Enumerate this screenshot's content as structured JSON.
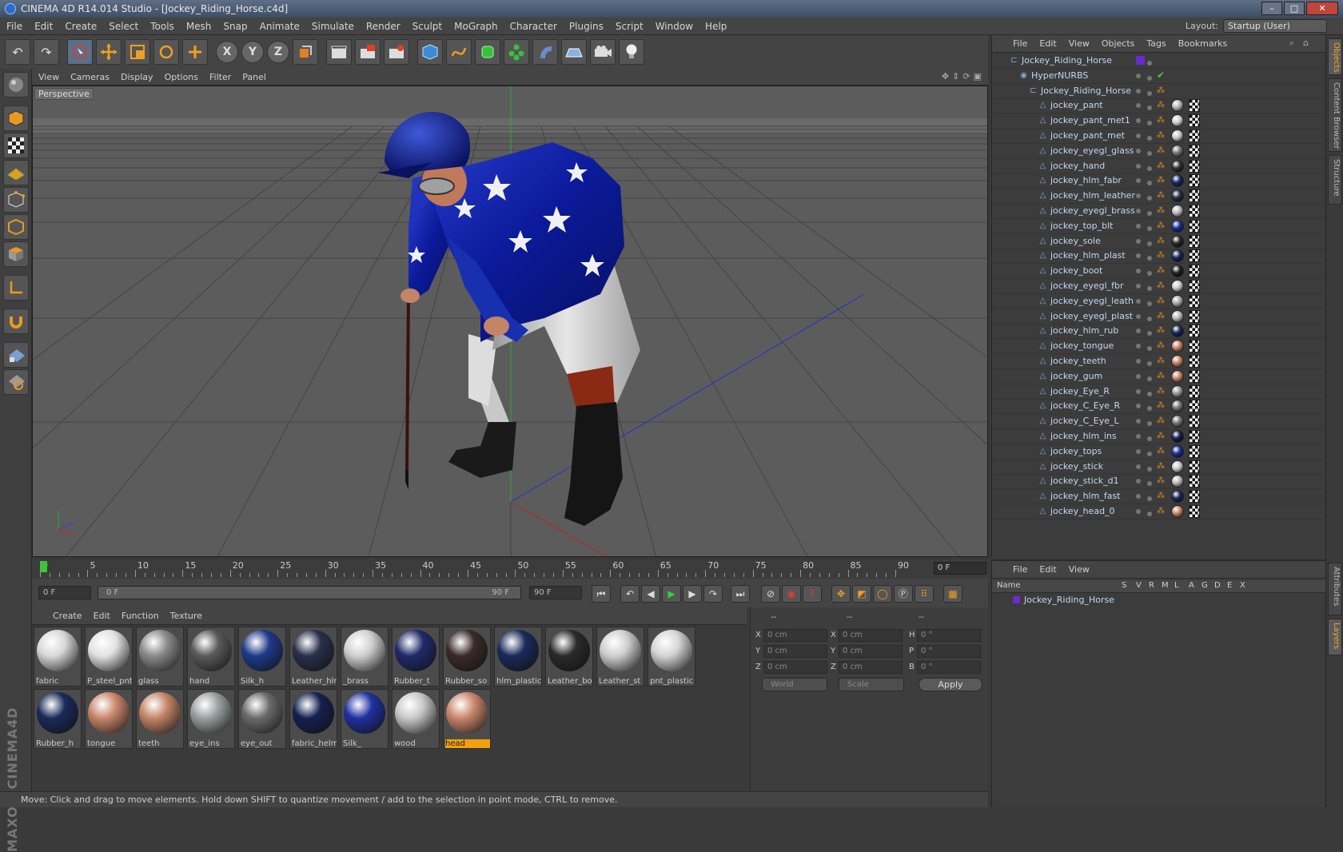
{
  "window": {
    "title": "CINEMA 4D R14.014 Studio - [Jockey_Riding_Horse.c4d]",
    "buttons": [
      "–",
      "□",
      "✕"
    ]
  },
  "menubar": {
    "items": [
      "File",
      "Edit",
      "Create",
      "Select",
      "Tools",
      "Mesh",
      "Snap",
      "Animate",
      "Simulate",
      "Render",
      "Sculpt",
      "MoGraph",
      "Character",
      "Plugins",
      "Script",
      "Window",
      "Help"
    ],
    "layout_label": "Layout:",
    "layout_value": "Startup (User)"
  },
  "toolbar": {
    "undo_icon": "↶",
    "redo_icon": "↷",
    "axis_x": "X",
    "axis_y": "Y",
    "axis_z": "Z"
  },
  "viewport": {
    "menu": [
      "View",
      "Cameras",
      "Display",
      "Options",
      "Filter",
      "Panel"
    ],
    "camera_label": "Perspective"
  },
  "timeline": {
    "ticks": [
      "0",
      "5",
      "10",
      "15",
      "20",
      "25",
      "30",
      "35",
      "40",
      "45",
      "50",
      "55",
      "60",
      "65",
      "70",
      "75",
      "80",
      "85",
      "90"
    ],
    "current_frame": "0 F"
  },
  "transport": {
    "start_field": "0 F",
    "range_start": "0 F",
    "range_end": "90 F",
    "end_field": "90 F"
  },
  "materials": {
    "menu": [
      "Create",
      "Edit",
      "Function",
      "Texture"
    ],
    "items": [
      {
        "name": "fabric",
        "color": "#d8d8d8"
      },
      {
        "name": "P_steel_pnt",
        "color": "#e2e2e2"
      },
      {
        "name": "glass",
        "color": "#8a8a8a"
      },
      {
        "name": "hand",
        "color": "#5a5a5a"
      },
      {
        "name": "Silk_h",
        "color": "#1e3a8a"
      },
      {
        "name": "Leather_hlm",
        "color": "#2a2f4a"
      },
      {
        "name": "_brass",
        "color": "#d0d0d0"
      },
      {
        "name": "Rubber_t",
        "color": "#202a6a"
      },
      {
        "name": "Rubber_so",
        "color": "#3a2a2a"
      },
      {
        "name": "hlm_plastic",
        "color": "#1a2a5a"
      },
      {
        "name": "Leather_bo",
        "color": "#2a2a2a"
      },
      {
        "name": "Leather_st",
        "color": "#cfcfcf"
      },
      {
        "name": "pnt_plastic",
        "color": "#d4d4d4"
      },
      {
        "name": "Rubber_h",
        "color": "#1a2a5a"
      },
      {
        "name": "tongue",
        "color": "#c9866a"
      },
      {
        "name": "teeth",
        "color": "#c48566"
      },
      {
        "name": "eye_ins",
        "color": "#9aa0a0"
      },
      {
        "name": "eye_out",
        "color": "#6a6a6a"
      },
      {
        "name": "fabric_helm",
        "color": "#152050"
      },
      {
        "name": "Silk_",
        "color": "#2030a0"
      },
      {
        "name": "wood",
        "color": "#c8c8c8"
      },
      {
        "name": "head",
        "color": "#c9866a",
        "selected": true
      }
    ]
  },
  "coordinates": {
    "headers": [
      "--",
      "--",
      "--"
    ],
    "rows": [
      {
        "a": "X",
        "av": "0 cm",
        "b": "X",
        "bv": "0 cm",
        "c": "H",
        "cv": "0 °"
      },
      {
        "a": "Y",
        "av": "0 cm",
        "b": "Y",
        "bv": "0 cm",
        "c": "P",
        "cv": "0 °"
      },
      {
        "a": "Z",
        "av": "0 cm",
        "b": "Z",
        "bv": "0 cm",
        "c": "B",
        "cv": "0 °"
      }
    ],
    "space": "World",
    "mode": "Scale",
    "apply": "Apply"
  },
  "status": "Move: Click and drag to move elements. Hold down SHIFT to quantize movement / add to the selection in point mode, CTRL to remove.",
  "objects": {
    "menu": [
      "File",
      "Edit",
      "View",
      "Objects",
      "Tags",
      "Bookmarks"
    ],
    "root": "Jockey_Riding_Horse",
    "hypernurbs": "HyperNURBS",
    "group": "Jockey_Riding_Horse",
    "children": [
      {
        "name": "jockey_pant",
        "mat": "#b8b8b8"
      },
      {
        "name": "jockey_pant_met1",
        "mat": "#d0d0d0"
      },
      {
        "name": "jockey_pant_met",
        "mat": "#c8c8c8"
      },
      {
        "name": "jockey_eyegl_glass",
        "mat": "#777777"
      },
      {
        "name": "jockey_hand",
        "mat": "#333333"
      },
      {
        "name": "jockey_hlm_fabr",
        "mat": "#1a2a6a"
      },
      {
        "name": "jockey_hlm_leather",
        "mat": "#2a2f4a"
      },
      {
        "name": "jockey_eyegl_brass",
        "mat": "#bbbbbb"
      },
      {
        "name": "jockey_top_blt",
        "mat": "#2030a0"
      },
      {
        "name": "jockey_sole",
        "mat": "#2a2a2a"
      },
      {
        "name": "jockey_hlm_plast",
        "mat": "#1a2a5a"
      },
      {
        "name": "jockey_boot",
        "mat": "#222222"
      },
      {
        "name": "jockey_eyegl_fbr",
        "mat": "#cccccc"
      },
      {
        "name": "jockey_eyegl_leath",
        "mat": "#aaaaaa"
      },
      {
        "name": "jockey_eyegl_plast",
        "mat": "#bbbbbb"
      },
      {
        "name": "jockey_hlm_rub",
        "mat": "#1a2a5a"
      },
      {
        "name": "jockey_tongue",
        "mat": "#c9866a"
      },
      {
        "name": "jockey_teeth",
        "mat": "#c48566"
      },
      {
        "name": "jockey_gum",
        "mat": "#c9866a"
      },
      {
        "name": "jockey_Eye_R",
        "mat": "#999999"
      },
      {
        "name": "jockey_C_Eye_R",
        "mat": "#777777"
      },
      {
        "name": "jockey_C_Eye_L",
        "mat": "#777777"
      },
      {
        "name": "jockey_hlm_ins",
        "mat": "#152050"
      },
      {
        "name": "jockey_tops",
        "mat": "#2030a0"
      },
      {
        "name": "jockey_stick",
        "mat": "#cccccc"
      },
      {
        "name": "jockey_stick_d1",
        "mat": "#bbbbbb"
      },
      {
        "name": "jockey_hlm_fast",
        "mat": "#1a2a5a"
      },
      {
        "name": "jockey_head_0",
        "mat": "#c9866a"
      }
    ]
  },
  "layers": {
    "menu": [
      "File",
      "Edit",
      "View"
    ],
    "columns": [
      "Name",
      "S",
      "V",
      "R",
      "M",
      "L",
      "A",
      "G",
      "D",
      "E",
      "X"
    ],
    "row_name": "Jockey_Riding_Horse"
  },
  "right_tabs": [
    "Objects",
    "Content Browser",
    "Structure",
    "Attributes",
    "Layers"
  ]
}
